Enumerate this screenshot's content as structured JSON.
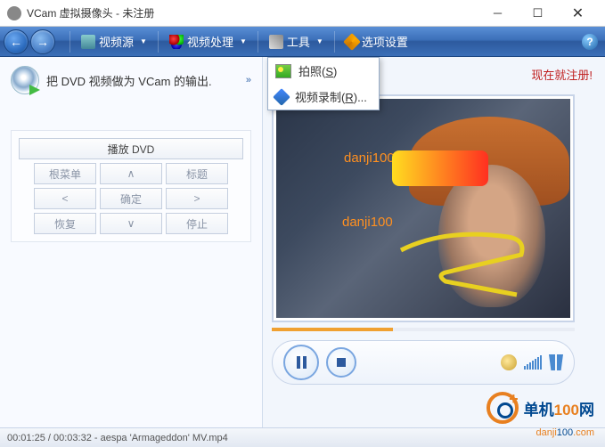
{
  "window": {
    "title": "VCam 虚拟摄像头 - 未注册"
  },
  "toolbar": {
    "video_source": "视频源",
    "video_process": "视频处理",
    "tools": "工具",
    "options": "选项设置",
    "help": "?"
  },
  "dropdown": {
    "photo_prefix": "拍照(",
    "photo_key": "S",
    "photo_suffix": ")",
    "record_prefix": "视频录制(",
    "record_key": "R",
    "record_suffix": ")..."
  },
  "left": {
    "info": "把 DVD 视频做为 VCam 的输出.",
    "chev": "»",
    "play_dvd": "播放 DVD",
    "root_menu": "根菜单",
    "up": "∧",
    "title_btn": "标题",
    "left_btn": "<",
    "ok": "确定",
    "right_btn": ">",
    "resume": "恢复",
    "down": "∨",
    "stop": "停止"
  },
  "right": {
    "register": "现在就注册!",
    "watermark1": "danji100",
    "watermark2": "danji100"
  },
  "status": {
    "text": "00:01:25 / 00:03:32 - aespa 'Armageddon' MV.mp4"
  },
  "branding": {
    "text_cn": "单机",
    "text_num": "100",
    "text_suffix": "网",
    "url_host": "danji",
    "url_num": "100",
    "url_tld": ".com"
  }
}
